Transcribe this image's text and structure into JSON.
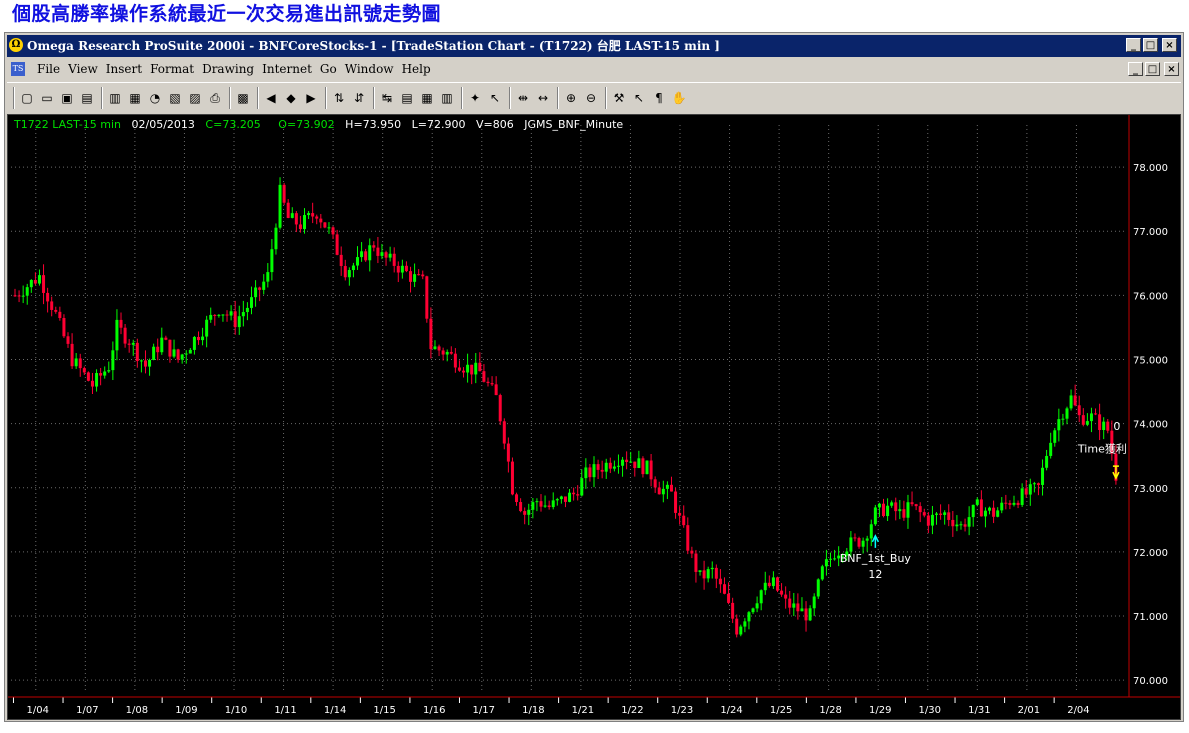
{
  "page_title": "個股高勝率操作系統最近一次交易進出訊號走勢圖",
  "window": {
    "title": "Omega Research ProSuite 2000i - BNFCoreStocks-1 - [TradeStation Chart - (T1722) 台肥 LAST-15 min ]",
    "buttons": [
      "_",
      "□",
      "×"
    ]
  },
  "menu": {
    "items": [
      "File",
      "View",
      "Insert",
      "Format",
      "Drawing",
      "Internet",
      "Go",
      "Window",
      "Help"
    ],
    "buttons": [
      "_",
      "□",
      "×"
    ]
  },
  "toolbar": {
    "icons": [
      "new-icon",
      "open-icon",
      "save-all-icon",
      "open-folder-icon",
      "print-preview-icon",
      "bar-chart-icon",
      "pie-icon",
      "report-icon",
      "analysis-icon",
      "print-icon",
      "properties-icon",
      "insert-prev-icon",
      "insert-mid-icon",
      "insert-next-icon",
      "format-indicator-icon",
      "format-strategy-icon",
      "symbol-link-icon",
      "data-window-icon",
      "grid-icon",
      "table-icon",
      "expert-icon",
      "pointer-icon",
      "zoom-bars-icon",
      "spacing-icon",
      "zoom-in-icon",
      "zoom-out-icon",
      "tools-icon",
      "cursor-icon",
      "text-icon",
      "hand-icon"
    ]
  },
  "status": {
    "symbol": "T1722 LAST-15 min",
    "date": "02/05/2013",
    "close": "C=73.205",
    "open": "O=73.902",
    "high": "H=73.950",
    "low": "L=72.900",
    "volume": "V=806",
    "strategy": "JGMS_BNF_Minute"
  },
  "colors": {
    "background": "#000000",
    "up_bar": "#00ff00",
    "down_bar": "#ff0033",
    "grid": "#6a6a6a",
    "axis": "#c00000",
    "buy_signal": "#00ffff",
    "exit_signal": "#ffff00"
  },
  "signals": {
    "buy_label": "BNF_1st_Buy",
    "buy_qty": "12",
    "exit_label": "Time獲利",
    "exit_qty": "0"
  },
  "chart_data": {
    "type": "candlestick",
    "x_ticks": [
      "1/04",
      "1/07",
      "1/08",
      "1/09",
      "1/10",
      "1/11",
      "1/14",
      "1/15",
      "1/16",
      "1/17",
      "1/18",
      "1/21",
      "1/22",
      "1/23",
      "1/24",
      "1/25",
      "1/28",
      "1/29",
      "1/30",
      "1/31",
      "2/01",
      "2/04"
    ],
    "y_ticks": [
      "78.000",
      "77.000",
      "76.000",
      "75.000",
      "74.000",
      "73.000",
      "72.000",
      "71.000",
      "70.000"
    ],
    "ylim": [
      69.8,
      78.5
    ],
    "path": [
      [
        0,
        76.0
      ],
      [
        6,
        76.3
      ],
      [
        10,
        75.7
      ],
      [
        14,
        75.0
      ],
      [
        19,
        74.6
      ],
      [
        23,
        74.9
      ],
      [
        25,
        75.5
      ],
      [
        28,
        75.3
      ],
      [
        32,
        74.9
      ],
      [
        36,
        75.3
      ],
      [
        40,
        75.0
      ],
      [
        45,
        75.4
      ],
      [
        50,
        75.8
      ],
      [
        54,
        75.6
      ],
      [
        58,
        75.9
      ],
      [
        62,
        76.3
      ],
      [
        65,
        77.6
      ],
      [
        67,
        77.2
      ],
      [
        70,
        77.1
      ],
      [
        74,
        77.3
      ],
      [
        77,
        77.0
      ],
      [
        79,
        76.7
      ],
      [
        81,
        76.4
      ],
      [
        84,
        76.5
      ],
      [
        88,
        76.8
      ],
      [
        90,
        76.6
      ],
      [
        93,
        76.5
      ],
      [
        97,
        76.3
      ],
      [
        100,
        76.2
      ],
      [
        102,
        75.2
      ],
      [
        106,
        75.1
      ],
      [
        110,
        74.9
      ],
      [
        114,
        74.8
      ],
      [
        118,
        74.4
      ],
      [
        120,
        73.8
      ],
      [
        122,
        73.0
      ],
      [
        125,
        72.6
      ],
      [
        128,
        72.8
      ],
      [
        131,
        72.7
      ],
      [
        134,
        72.8
      ],
      [
        137,
        72.9
      ],
      [
        140,
        73.2
      ],
      [
        143,
        73.3
      ],
      [
        146,
        73.4
      ],
      [
        149,
        73.5
      ],
      [
        152,
        73.4
      ],
      [
        155,
        73.3
      ],
      [
        158,
        73.0
      ],
      [
        161,
        72.9
      ],
      [
        164,
        72.3
      ],
      [
        166,
        71.9
      ],
      [
        168,
        71.6
      ],
      [
        171,
        71.7
      ],
      [
        174,
        71.3
      ],
      [
        177,
        70.8
      ],
      [
        180,
        71.1
      ],
      [
        183,
        71.4
      ],
      [
        186,
        71.5
      ],
      [
        189,
        71.2
      ],
      [
        192,
        71.1
      ],
      [
        195,
        71.0
      ],
      [
        198,
        71.7
      ],
      [
        201,
        72.0
      ],
      [
        204,
        72.1
      ],
      [
        208,
        72.2
      ],
      [
        211,
        72.6
      ],
      [
        214,
        72.7
      ],
      [
        217,
        72.6
      ],
      [
        220,
        72.7
      ],
      [
        224,
        72.5
      ],
      [
        228,
        72.6
      ],
      [
        232,
        72.4
      ],
      [
        236,
        72.7
      ],
      [
        240,
        72.6
      ],
      [
        244,
        72.8
      ],
      [
        248,
        72.9
      ],
      [
        251,
        73.0
      ],
      [
        254,
        73.8
      ],
      [
        257,
        74.2
      ],
      [
        259,
        74.4
      ],
      [
        261,
        74.1
      ],
      [
        264,
        74.1
      ],
      [
        266,
        74.0
      ],
      [
        268,
        73.9
      ],
      [
        270,
        73.2
      ]
    ],
    "bar_count": 271
  }
}
